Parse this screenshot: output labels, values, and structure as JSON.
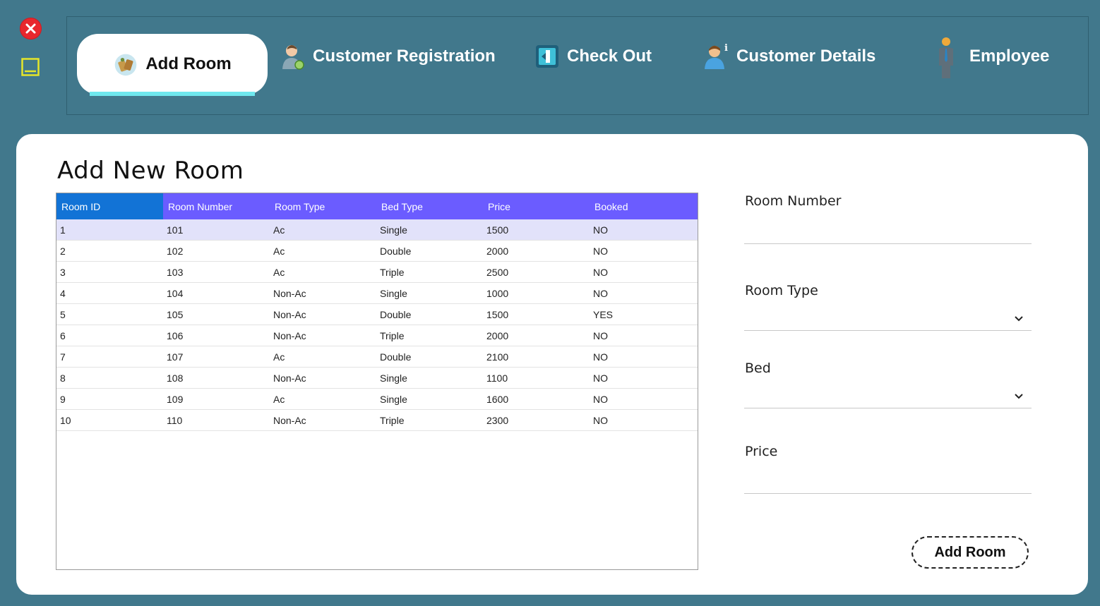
{
  "nav": {
    "tabs": [
      {
        "label": "Add Room",
        "icon": "room-key-icon",
        "active": true
      },
      {
        "label": "Customer Registration",
        "icon": "customer-registration-icon"
      },
      {
        "label": "Check Out",
        "icon": "check-out-icon"
      },
      {
        "label": "Customer Details",
        "icon": "customer-details-icon"
      },
      {
        "label": "Employee",
        "icon": "employee-icon"
      }
    ]
  },
  "colors": {
    "background": "#41788c",
    "header_blue": "#1273d6",
    "header_purple": "#6b5cff",
    "active_underline": "#6ee8ee",
    "close_red": "#e8272d"
  },
  "main": {
    "title": "Add New Room",
    "table": {
      "columns": [
        "Room ID",
        "Room Number",
        "Room Type",
        "Bed Type",
        "Price",
        "Booked"
      ],
      "rows": [
        [
          "1",
          "101",
          "Ac",
          "Single",
          "1500",
          "NO"
        ],
        [
          "2",
          "102",
          "Ac",
          "Double",
          "2000",
          "NO"
        ],
        [
          "3",
          "103",
          "Ac",
          "Triple",
          "2500",
          "NO"
        ],
        [
          "4",
          "104",
          "Non-Ac",
          "Single",
          "1000",
          "NO"
        ],
        [
          "5",
          "105",
          "Non-Ac",
          "Double",
          "1500",
          "YES"
        ],
        [
          "6",
          "106",
          "Non-Ac",
          "Triple",
          "2000",
          "NO"
        ],
        [
          "7",
          "107",
          "Ac",
          "Double",
          "2100",
          "NO"
        ],
        [
          "8",
          "108",
          "Non-Ac",
          "Single",
          "1100",
          "NO"
        ],
        [
          "9",
          "109",
          "Ac",
          "Single",
          "1600",
          "NO"
        ],
        [
          "10",
          "110",
          "Non-Ac",
          "Triple",
          "2300",
          "NO"
        ]
      ]
    }
  },
  "form": {
    "room_number_label": "Room Number",
    "room_number_value": "",
    "room_type_label": "Room Type",
    "room_type_value": "",
    "bed_label": "Bed",
    "bed_value": "",
    "price_label": "Price",
    "price_value": "",
    "submit_label": "Add Room"
  }
}
